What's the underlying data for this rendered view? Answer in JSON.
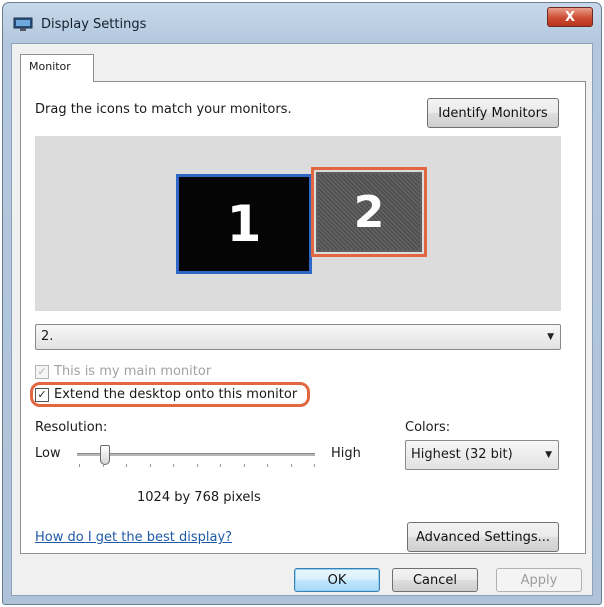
{
  "window": {
    "title": "Display Settings",
    "close_label": "X"
  },
  "tabs": [
    {
      "label": "Monitor"
    }
  ],
  "monitor": {
    "instruction": "Drag the icons to match your monitors.",
    "identify_label": "Identify Monitors",
    "monitors": [
      {
        "label": "1"
      },
      {
        "label": "2"
      }
    ],
    "selected_monitor": "2.",
    "main_monitor_label": "This is my main monitor",
    "main_monitor_checked": true,
    "extend_label": "Extend the desktop onto this monitor",
    "extend_checked": true,
    "check_glyph": "✓",
    "resolution": {
      "label": "Resolution:",
      "low": "Low",
      "high": "High",
      "current": "1024 by 768 pixels",
      "slider_position": 0.1
    },
    "colors": {
      "label": "Colors:",
      "value": "Highest (32 bit)"
    },
    "help_link": "How do I get the best display?",
    "advanced_label": "Advanced Settings..."
  },
  "footer": {
    "ok": "OK",
    "cancel": "Cancel",
    "apply": "Apply"
  },
  "colors": {
    "highlight": "#e0673f",
    "selected_monitor_border": "#2f67c9",
    "link": "#1f5aa8"
  },
  "icons": {
    "caret": "▼"
  }
}
